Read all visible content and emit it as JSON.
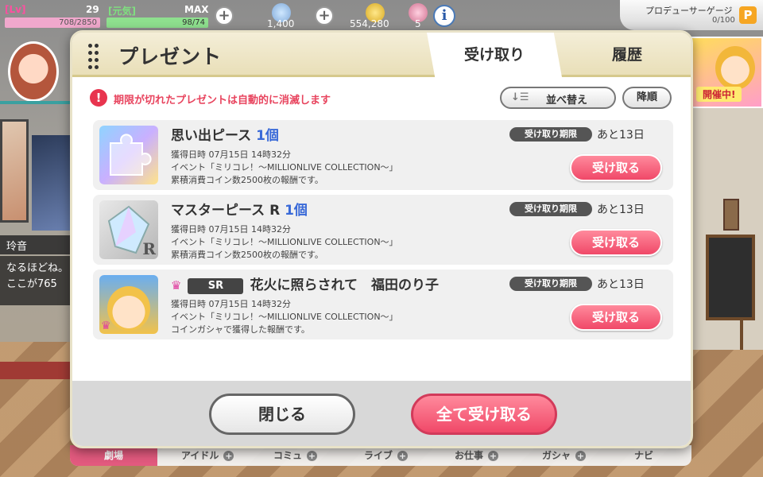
{
  "status": {
    "lv_label": "[Lv]",
    "lv_value": "29",
    "genki_label": "[元気]",
    "max_label": "MAX",
    "exp": "708/2850",
    "stamina": "98/74",
    "stamina_fraction": 1.0,
    "jewels": "1,400",
    "money": "554,280",
    "gacha_tickets": "5",
    "produce_gauge_label": "プロデューサーゲージ",
    "produce_gauge_value": "0/100",
    "produce_icon": "P"
  },
  "left_panel": {
    "name": "玲音",
    "talk_line1": "なるほどね。",
    "talk_line2": "ここが765"
  },
  "event_banner": {
    "badge": "開催中!"
  },
  "bottom_nav": [
    "劇場",
    "アイドル",
    "コミュ",
    "ライブ",
    "お仕事",
    "ガシャ",
    "ナビ"
  ],
  "modal": {
    "title": "プレゼント",
    "tabs": {
      "receive": "受け取り",
      "history": "履歴"
    },
    "notice_icon": "!",
    "notice": "期限が切れたプレゼントは自動的に消滅します",
    "sort_label": "並べ替え",
    "order_label": "降順",
    "deadline_label": "受け取り期限",
    "items": [
      {
        "name": "思い出ピース",
        "count": "1個",
        "remaining": "あと13日",
        "obtained": "獲得日時 07月15日 14時32分",
        "source": "イベント「ミリコレ！～MILLIONLIVE COLLECTION～」",
        "reason": "累積消費コイン数2500枚の報酬です。",
        "button": "受け取る",
        "thumb": "puzzle-piece-icon"
      },
      {
        "name": "マスターピース R",
        "count": "1個",
        "remaining": "あと13日",
        "obtained": "獲得日時 07月15日 14時32分",
        "source": "イベント「ミリコレ！～MILLIONLIVE COLLECTION～」",
        "reason": "累積消費コイン数2500枚の報酬です。",
        "button": "受け取る",
        "thumb": "crystal-icon",
        "thumb_letter": "R"
      },
      {
        "rarity": "SR",
        "name": "花火に照らされて　福田のり子",
        "remaining": "あと13日",
        "obtained": "獲得日時 07月15日 14時32分",
        "source": "イベント「ミリコレ！～MILLIONLIVE COLLECTION～」",
        "reason": "コインガシャで獲得した報酬です。",
        "button": "受け取る",
        "thumb": "idol-card-icon"
      }
    ],
    "close_button": "閉じる",
    "receive_all_button": "全て受け取る"
  },
  "colors": {
    "accent_pink": "#f04868",
    "notice_red": "#e8445e",
    "count_blue": "#3a6ad8",
    "header_cream": "#ece3c0"
  }
}
